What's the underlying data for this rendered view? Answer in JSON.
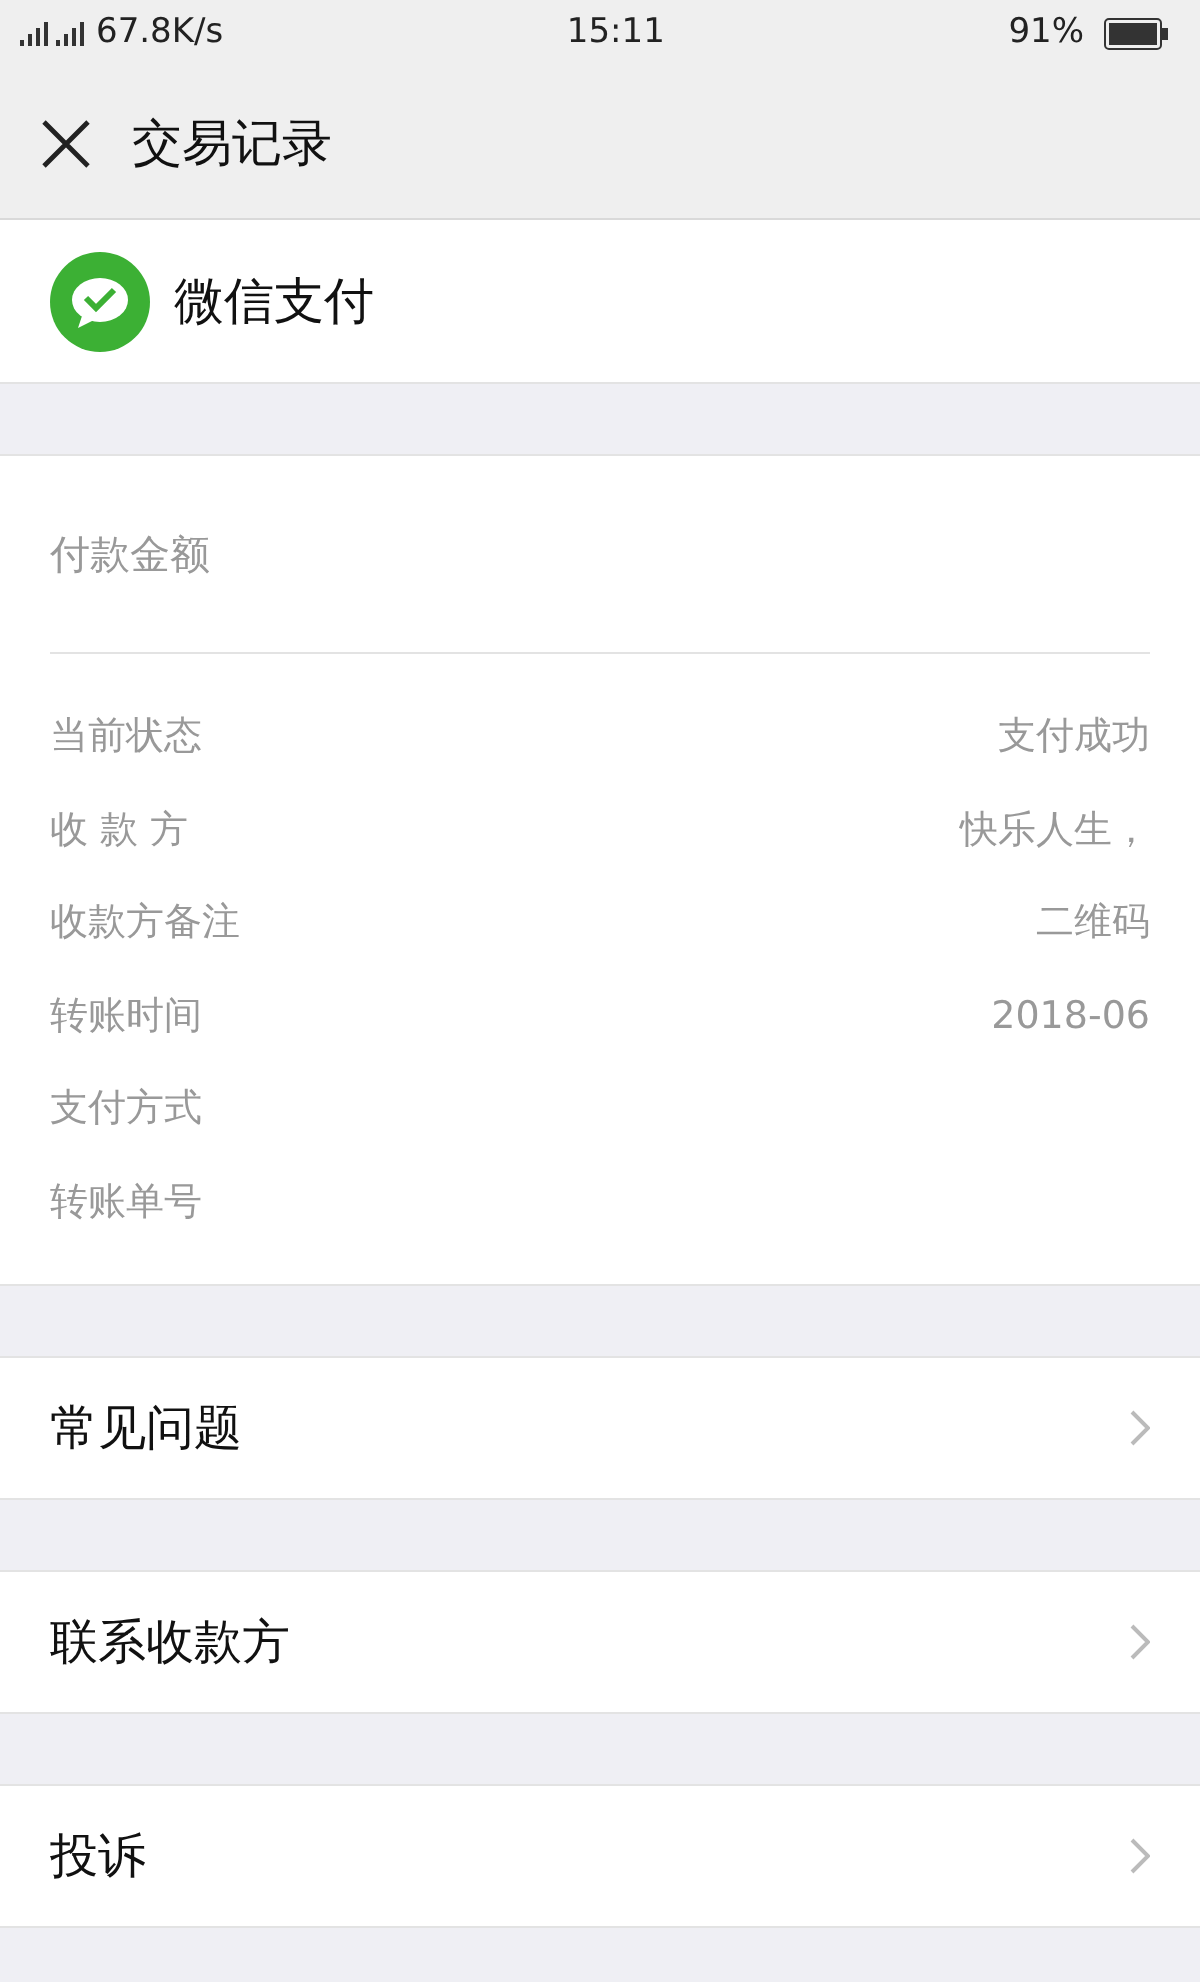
{
  "status_bar": {
    "network": "67.8K/s",
    "time": "15:11",
    "battery": "91%"
  },
  "header": {
    "title": "交易记录"
  },
  "merchant": {
    "name": "微信支付"
  },
  "amount": {
    "label": "付款金额"
  },
  "details": [
    {
      "label": "当前状态",
      "value": "支付成功"
    },
    {
      "label": "收 款 方",
      "value": "快乐人生，"
    },
    {
      "label": "收款方备注",
      "value": "二维码"
    },
    {
      "label": "转账时间",
      "value": "2018-06"
    },
    {
      "label": "支付方式"
    },
    {
      "label": "转账单号"
    }
  ],
  "links": [
    {
      "label": "常见问题"
    },
    {
      "label": "联系收款方"
    },
    {
      "label": "投诉"
    }
  ]
}
